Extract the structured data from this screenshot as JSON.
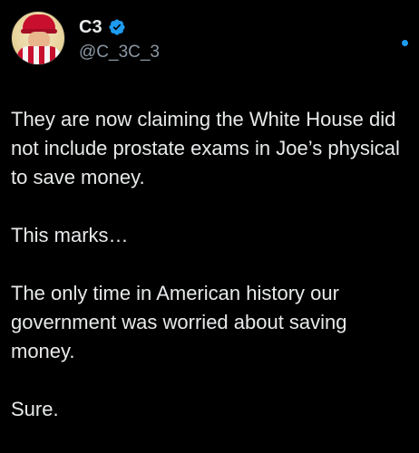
{
  "author": {
    "display_name": "C3",
    "handle": "@C_3C_3",
    "verified_icon": "verified-badge-icon",
    "avatar_icon": "avatar-image",
    "accent_color": "#1d9bf0"
  },
  "tweet": {
    "paragraphs": [
      "They are now claiming the White House did not include prostate exams in Joe’s physical to save money.",
      "This marks…",
      "The only time in American history our government was worried about saving money.",
      "Sure."
    ]
  },
  "colors": {
    "background": "#000000",
    "text": "#e7e9ea",
    "secondary_text": "#8b98a5",
    "verified": "#1d9bf0"
  }
}
